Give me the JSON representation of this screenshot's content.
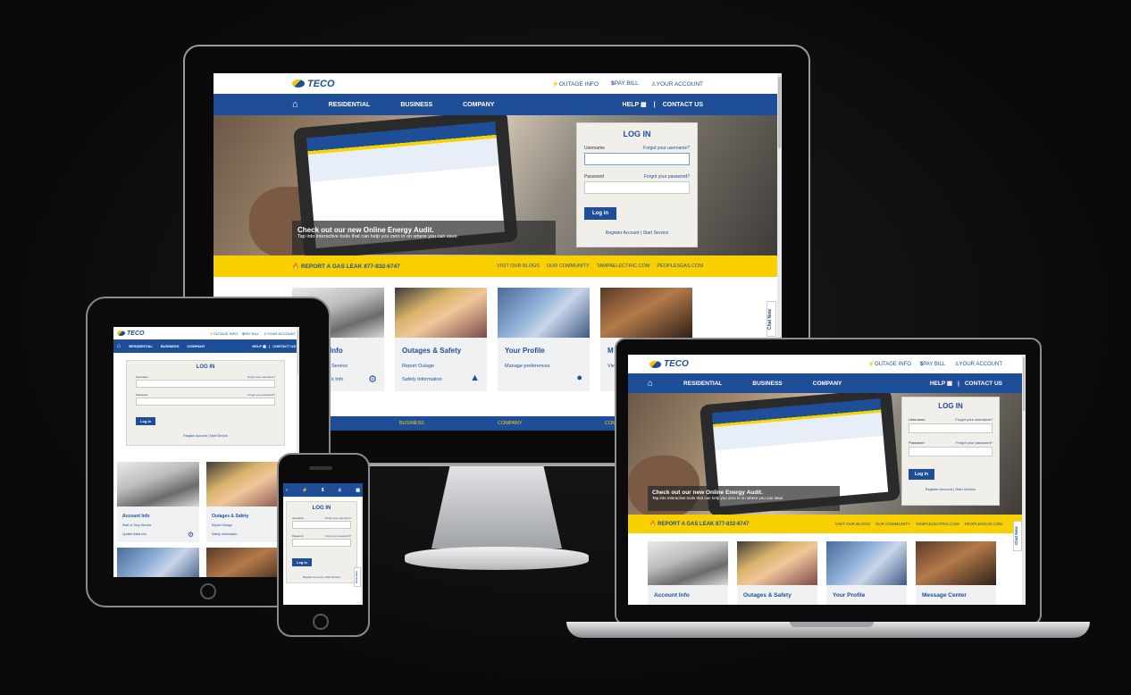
{
  "brand": {
    "logo_text": "TECO",
    "colors": {
      "primary": "#1f4e99",
      "accent": "#f8d000",
      "bg": "#0c0c0c"
    }
  },
  "utility": {
    "outage": "OUTAGE INFO",
    "pay": "PAY BILL",
    "account": "YOUR ACCOUNT"
  },
  "nav": {
    "home_icon": "home-icon",
    "residential": "RESIDENTIAL",
    "business": "BUSINESS",
    "company": "COMPANY",
    "help": "HELP",
    "contact": "CONTACT US",
    "divider": "|"
  },
  "hero": {
    "headline": "Check out our new Online Energy Audit.",
    "subline": "Tap into interactive tools that can help you zero in on where you can save."
  },
  "login": {
    "title": "LOG IN",
    "username_label": "Username",
    "forgot_username": "Forgot your username?",
    "password_label": "Password",
    "forgot_password": "Forgot your password?",
    "button": "Log in",
    "register": "Register Account",
    "sep": "|",
    "start": "Start Service"
  },
  "gas_bar": {
    "text": "REPORT A GAS LEAK 877-832-6747",
    "links": [
      "VISIT OUR BLOGS",
      "OUR COMMUNITY",
      "TAMPAELECTRIC.COM",
      "PEOPLESGAS.COM"
    ]
  },
  "tiles": [
    {
      "title": "Account Info",
      "links": [
        "Start or Stop Service",
        "Update Bank Info"
      ],
      "icon": "gear-icon"
    },
    {
      "title": "Outages & Safety",
      "links": [
        "Report Outage",
        "Safety Information"
      ],
      "icon": "warning-icon"
    },
    {
      "title": "Your Profile",
      "links": [
        "Manage preferences"
      ],
      "icon": "person-icon"
    },
    {
      "title": "Message Center",
      "links": [
        "View messages"
      ],
      "icon": "mail-icon"
    }
  ],
  "imac_partial": {
    "tile1_title": "Info",
    "tile1_link1": "Service",
    "tile1_link2": "k Info",
    "tile4_title": "M",
    "tile4_link": "Vie"
  },
  "footer_nav": {
    "business": "BUSINESS",
    "company": "COMPANY",
    "co": "COM"
  },
  "chat": "Chat Now"
}
